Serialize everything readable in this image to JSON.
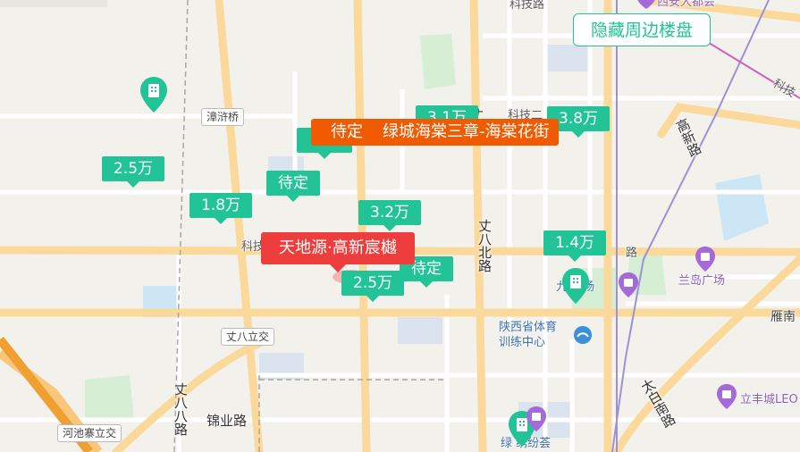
{
  "toggle_button": "隐藏周边楼盘",
  "highlights": {
    "current": "天地源·高新宸樾",
    "nearby_status": "待定",
    "nearby_name": "绿城海棠三章-海棠花街"
  },
  "price_markers": [
    {
      "id": "p1",
      "text": "2.5万"
    },
    {
      "id": "p2",
      "text": "1.8万"
    },
    {
      "id": "p3",
      "text": "待定"
    },
    {
      "id": "p4",
      "text": "3.2万"
    },
    {
      "id": "p5",
      "text": "1.4万"
    },
    {
      "id": "p6",
      "text": "待定"
    },
    {
      "id": "p7",
      "text": "2.5万"
    },
    {
      "id": "p8",
      "text": "3.1万"
    },
    {
      "id": "p9",
      "text": "3.8万"
    }
  ],
  "place_labels": {
    "zhanghuqiao": "漳浒桥",
    "keji_left": "科技",
    "keji_top_center": "科技二",
    "keji_top": "科技路",
    "keji_right": "科技",
    "zhangba_li": "丈八立交",
    "jinye_lu": "锦业路",
    "hechi_li": "河池寨立交",
    "yanan": "雁南",
    "lu_right": "路",
    "shanxi_sport": "陕西省体育\n训练中心",
    "lan_dao": "兰岛广场",
    "li_feng": "立丰城LEO",
    "lv_fang": "绿    绣纷荟",
    "guangchang_mid": "九     广场",
    "xiajun_top": "西安大都会"
  },
  "road_labels_vertical": {
    "zhangba_bei": "丈八北路",
    "zhangba_top": "丈路",
    "zhangba_ba": "丈八八路",
    "gaoxin": "高新路",
    "taibai_nan": "太白南路"
  },
  "colors": {
    "accent": "#22c497",
    "highlight_orange": "#f05a00",
    "highlight_red": "#ee3d3d"
  }
}
